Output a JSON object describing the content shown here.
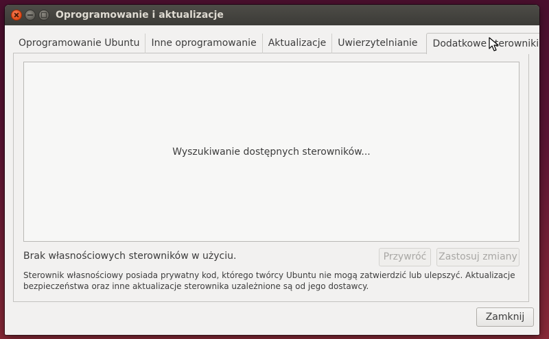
{
  "window": {
    "title": "Oprogramowanie i aktualizacje"
  },
  "tabs": [
    {
      "label": "Oprogramowanie Ubuntu",
      "active": false
    },
    {
      "label": "Inne oprogramowanie",
      "active": false
    },
    {
      "label": "Aktualizacje",
      "active": false
    },
    {
      "label": "Uwierzytelnianie",
      "active": false
    },
    {
      "label": "Dodatkowe sterowniki",
      "active": true
    }
  ],
  "drivers": {
    "searching_message": "Wyszukiwanie dostępnych sterowników...",
    "status": "Brak własnościowych sterowników w użyciu.",
    "revert_label": "Przywróć",
    "apply_label": "Zastosuj zmiany",
    "footnote": "Sterownik własnościowy posiada prywatny kod, którego twórcy Ubuntu nie mogą zatwierdzić lub ulepszyć. Aktualizacje bezpieczeństwa oraz inne aktualizacje sterownika uzależnione są od jego dostawcy."
  },
  "footer": {
    "close_label": "Zamknij"
  },
  "icons": {
    "close": "close-icon",
    "minimize": "minimize-icon",
    "maximize": "maximize-icon",
    "cursor": "mouse-pointer-icon"
  },
  "colors": {
    "titlebar": "#3c3b37",
    "close_button": "#df4a16",
    "window_bg": "#f2f1f0",
    "text": "#3c3c3c",
    "disabled_text": "#a8a7a4"
  }
}
